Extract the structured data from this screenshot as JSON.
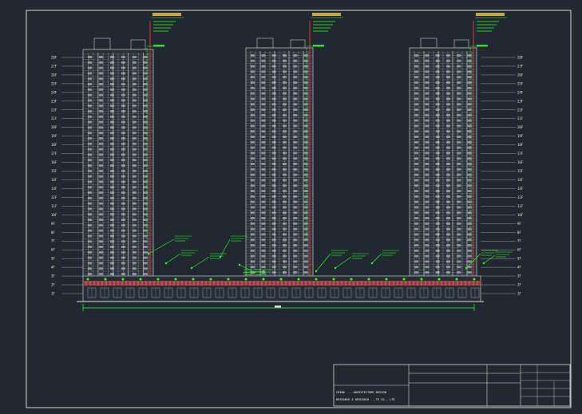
{
  "drawing": {
    "title": "",
    "floor_labels": [
      "1F",
      "2F",
      "3F",
      "4F",
      "5F",
      "6F",
      "7F",
      "8F",
      "9F",
      "10F",
      "11F",
      "12F",
      "13F",
      "14F",
      "15F",
      "16F",
      "17F",
      "18F",
      "19F",
      "20F",
      "21F",
      "22F",
      "23F",
      "24F",
      "25F",
      "26F",
      "27F",
      "28F"
    ],
    "colors": {
      "background": "#212830",
      "frame": "#d8d8d8",
      "annotation": "#33ff33",
      "riser": "#e03030",
      "annotation_title": "#ffd24a",
      "facade": "#c9c9c9",
      "podium": "#b84040"
    }
  },
  "title_block": {
    "company_cn": "",
    "company_en_1": "CHINA ... ARCHITECTURE DESIGN",
    "company_en_2": "RESEARCH & RESEARCH ...TE CO., LTD",
    "project_line_1": "",
    "project_line_2": "",
    "drawing_name": "",
    "fields": [
      "",
      "",
      "",
      "",
      "",
      ""
    ]
  }
}
